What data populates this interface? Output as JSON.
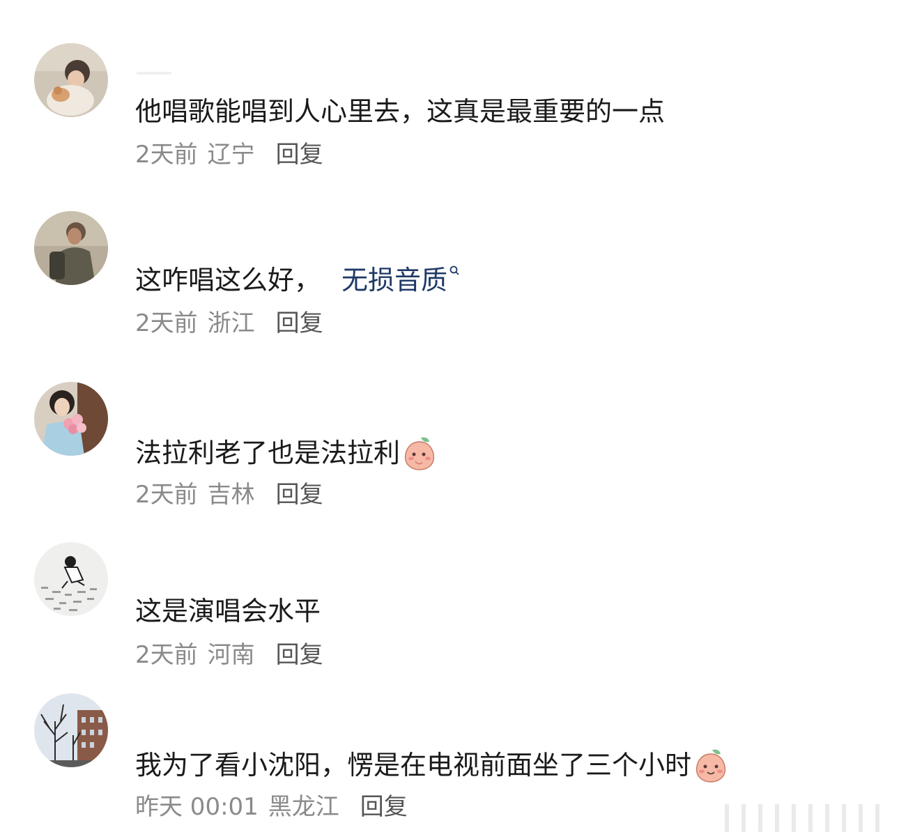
{
  "comments": [
    {
      "text": "他唱歌能唱到人心里去，这真是最重要的一点",
      "time": "2天前",
      "location": "辽宁",
      "reply_label": "回复",
      "avatar_icon": "avatar-woman-with-cat-icon"
    },
    {
      "text": "这咋唱这么好，",
      "topic_link": "无损音质",
      "time": "2天前",
      "location": "浙江",
      "reply_label": "回复",
      "avatar_icon": "avatar-man-with-backpack-icon"
    },
    {
      "text": "法拉利老了也是法拉利",
      "emoji": "peach-shy-emoji-icon",
      "time": "2天前",
      "location": "吉林",
      "reply_label": "回复",
      "avatar_icon": "avatar-woman-with-flowers-icon"
    },
    {
      "text": "这是演唱会水平",
      "time": "2天前",
      "location": "河南",
      "reply_label": "回复",
      "avatar_icon": "avatar-sketch-boy-icon"
    },
    {
      "text": "我为了看小沈阳，愣是在电视前面坐了三个小时",
      "emoji": "peach-smile-emoji-icon",
      "time": "昨天 00:01",
      "location": "黑龙江",
      "reply_label": "回复",
      "avatar_icon": "avatar-trees-building-icon"
    }
  ],
  "colors": {
    "text": "#1a1a1a",
    "meta": "#8a8a8a",
    "reply": "#555555",
    "topic_link": "#1f3a66"
  }
}
